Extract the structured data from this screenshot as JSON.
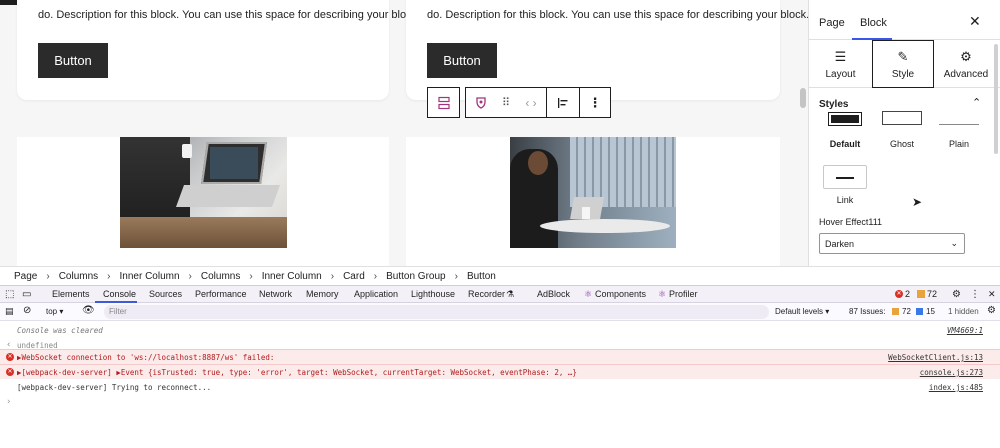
{
  "canvas": {
    "card_desc": "do. Description for this block. You can use this space for describing your block.",
    "button_label": "Button"
  },
  "sidebar": {
    "tabs": [
      {
        "label": "Page"
      },
      {
        "label": "Block"
      }
    ],
    "subtabs": [
      {
        "label": "Layout"
      },
      {
        "label": "Style"
      },
      {
        "label": "Advanced"
      }
    ],
    "styles_title": "Styles",
    "style_options": [
      {
        "label": "Default"
      },
      {
        "label": "Ghost"
      },
      {
        "label": "Plain"
      },
      {
        "label": "Link"
      }
    ],
    "hover_label": "Hover Effect111",
    "hover_value": "Darken"
  },
  "breadcrumb": [
    "Page",
    "Columns",
    "Inner Column",
    "Columns",
    "Inner Column",
    "Card",
    "Button Group",
    "Button"
  ],
  "devtools": {
    "tabs": [
      "Elements",
      "Console",
      "Sources",
      "Performance",
      "Network",
      "Memory",
      "Application",
      "Lighthouse",
      "Recorder",
      "AdBlock",
      "Components",
      "Profiler"
    ],
    "error_count": "2",
    "warn_count": "72",
    "context": "top",
    "filter_placeholder": "Filter",
    "levels": "Default levels",
    "issues_label": "87 Issues:",
    "issues_warn": "72",
    "issues_info": "15",
    "hidden": "1 hidden",
    "console": [
      {
        "text": "Console was cleared",
        "src": "VM4669:1"
      },
      {
        "text": "undefined",
        "src": ""
      },
      {
        "text": "▶WebSocket connection to 'ws://localhost:8887/ws' failed:",
        "src": "WebSocketClient.js:13"
      },
      {
        "text": "▶[webpack-dev-server]  ▶Event {isTrusted: true, type: 'error', target: WebSocket, currentTarget: WebSocket, eventPhase: 2, …}",
        "src": "console.js:273"
      },
      {
        "text": "[webpack-dev-server] Trying to reconnect...",
        "src": "index.js:485"
      }
    ]
  }
}
